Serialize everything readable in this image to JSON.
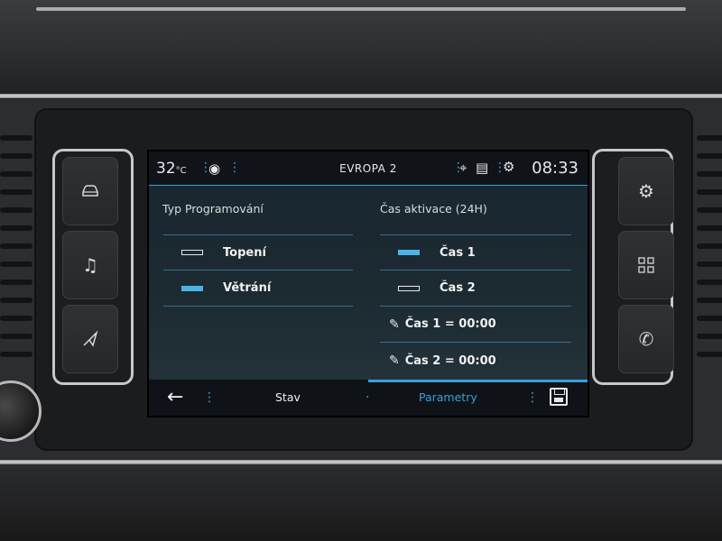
{
  "status_bar": {
    "temperature": "32",
    "temperature_unit": "°C",
    "station": "EVROPA 2",
    "time": "08:33",
    "icons": [
      "radio-signal-icon",
      "location-pin-icon",
      "notifications-icon",
      "settings-gears-icon"
    ]
  },
  "left_column": {
    "title": "Typ Programování",
    "items": [
      {
        "label": "Topení",
        "selected": false
      },
      {
        "label": "Větrání",
        "selected": true
      }
    ]
  },
  "right_column": {
    "title": "Čas aktivace (24H)",
    "items": [
      {
        "label": "Čas 1",
        "selected": true
      },
      {
        "label": "Čas 2",
        "selected": false
      }
    ],
    "edit_items": [
      {
        "label": "Čas 1 = 00:00"
      },
      {
        "label": "Čas 2 = 00:00"
      }
    ]
  },
  "bottom_bar": {
    "tabs": [
      {
        "label": "Stav",
        "active": false
      },
      {
        "label": "Parametry",
        "active": true
      }
    ],
    "icons": [
      "back-arrow-icon",
      "save-icon"
    ]
  },
  "hard_buttons": {
    "left": [
      "car-icon",
      "music-note-icon",
      "navigation-icon"
    ],
    "right": [
      "settings-icon",
      "apps-grid-icon",
      "phone-icon"
    ]
  },
  "colors": {
    "accent": "#3aa0d9",
    "selected_bar": "#4cb3e8",
    "screen_bg": "#1a2730"
  }
}
